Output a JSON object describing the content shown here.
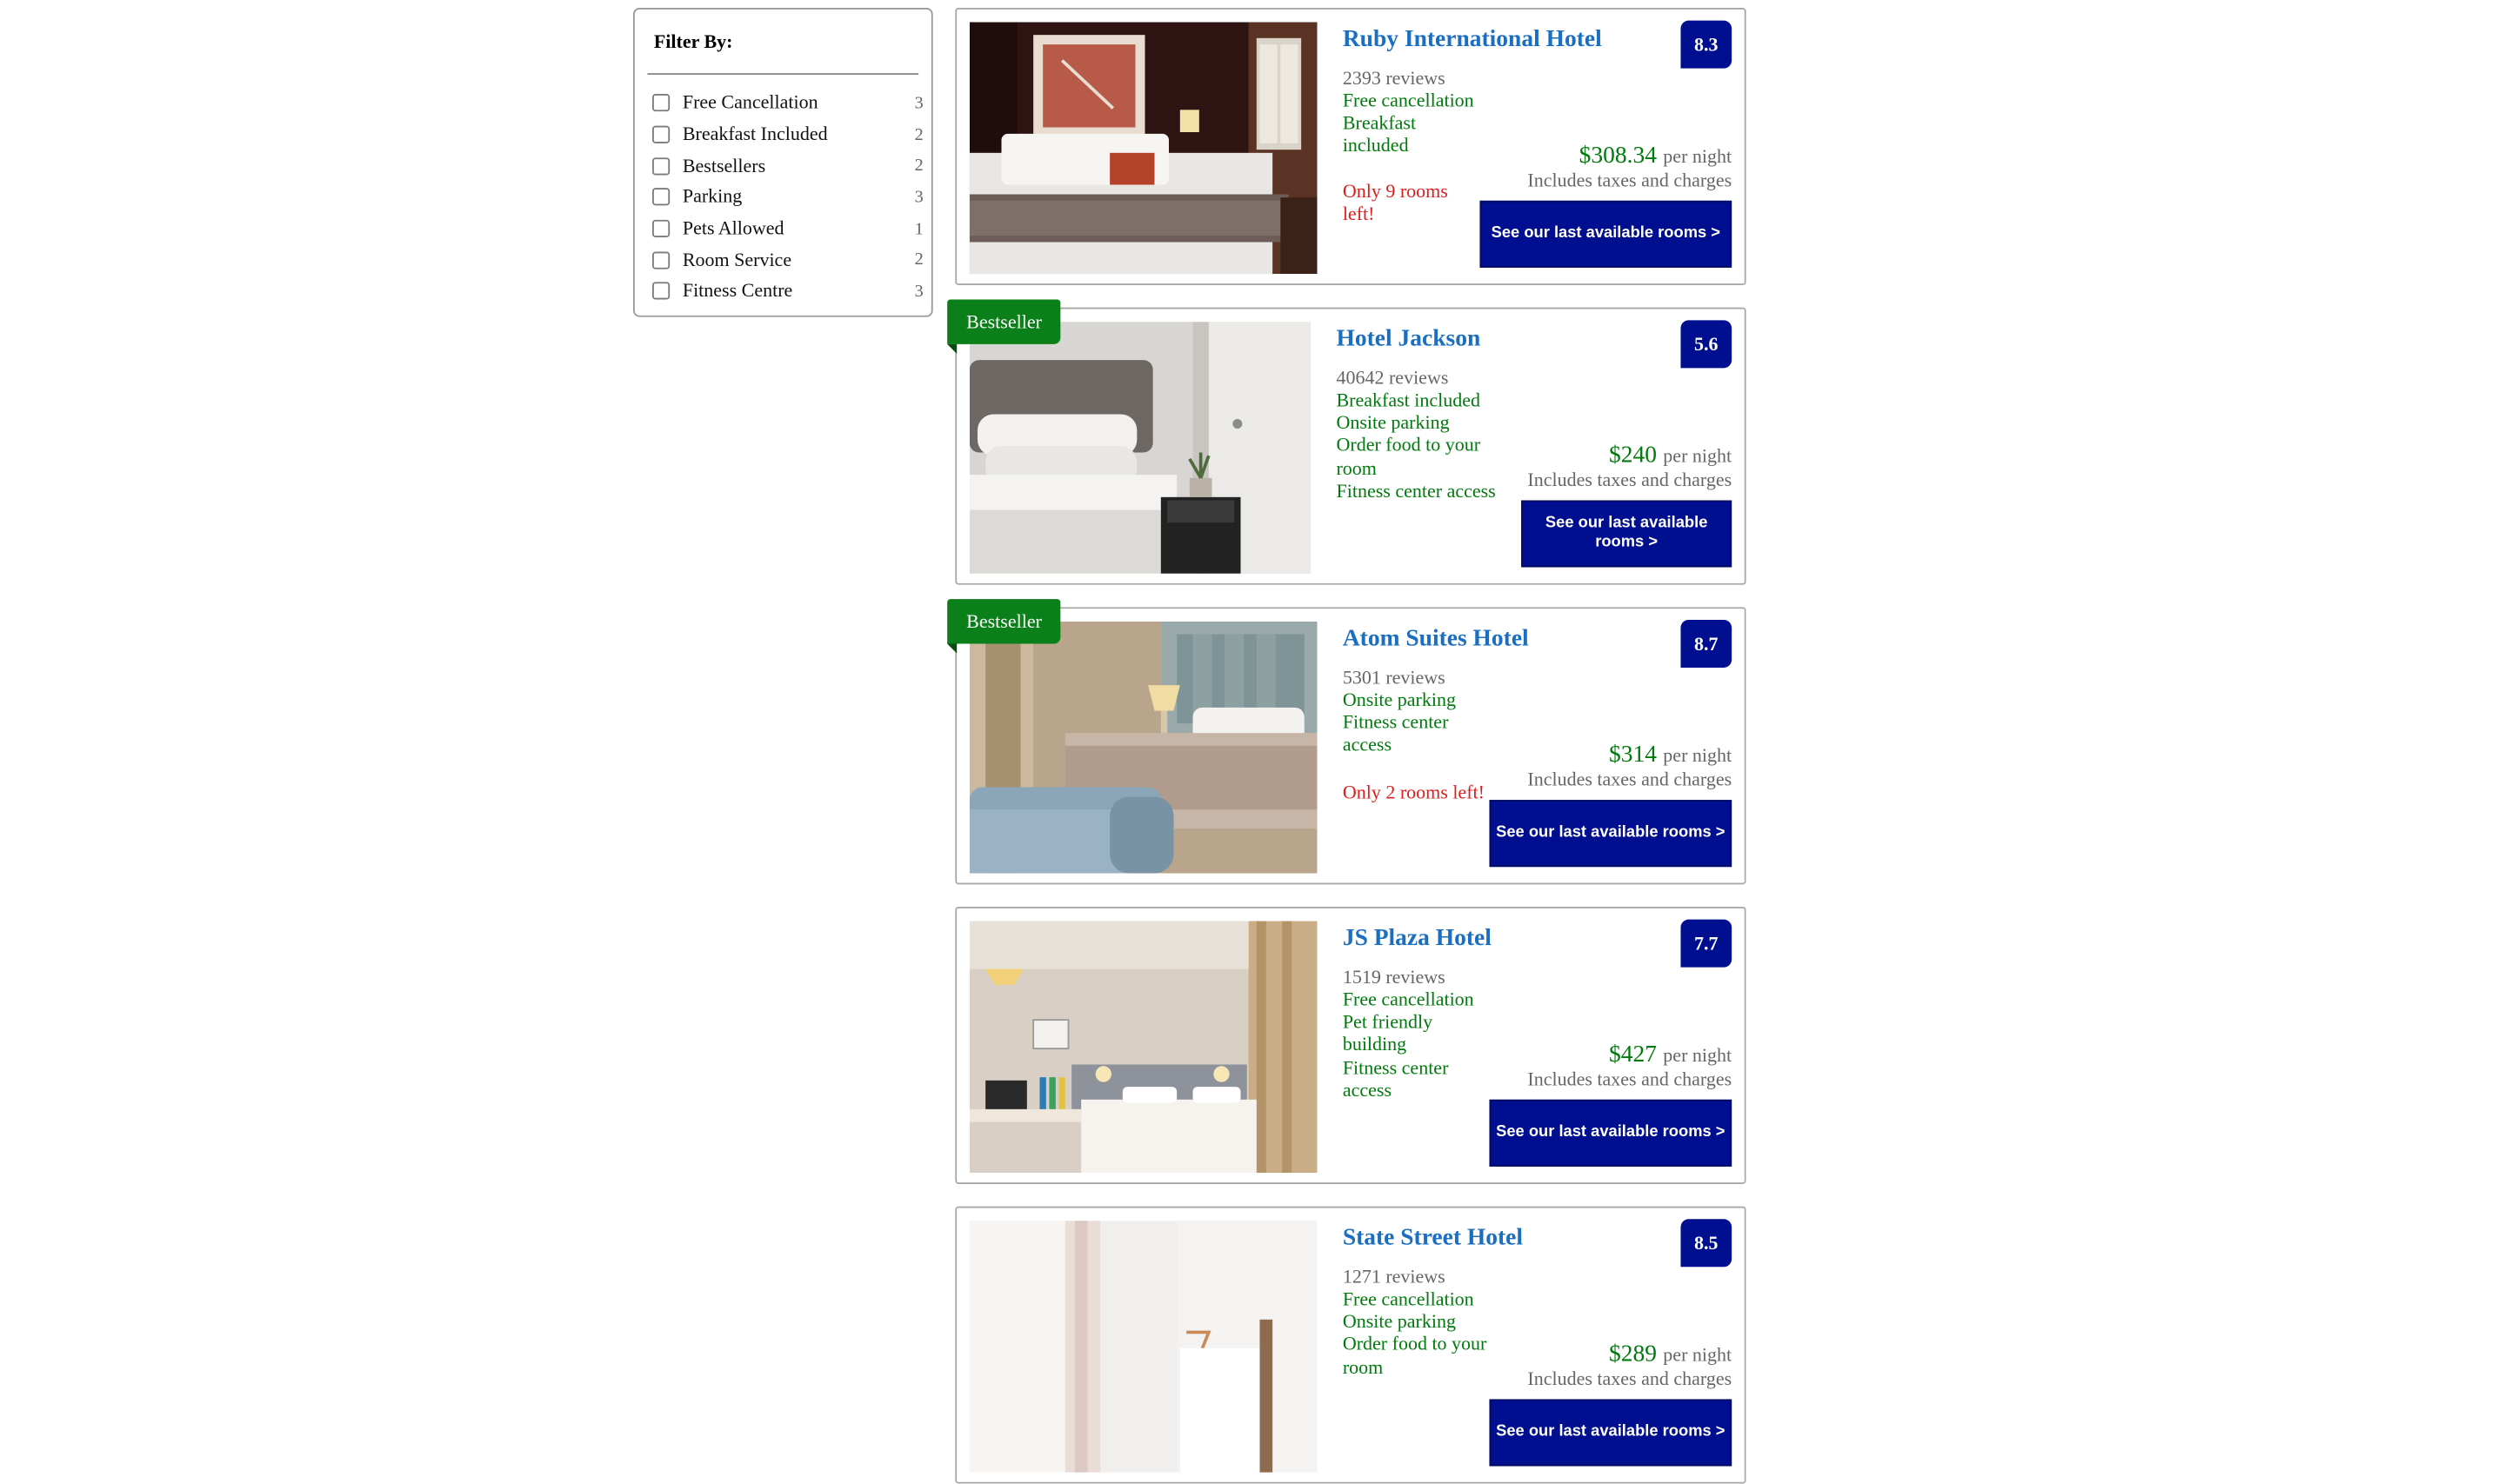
{
  "filters": {
    "title": "Filter By:",
    "items": [
      {
        "label": "Free Cancellation",
        "count": "3"
      },
      {
        "label": "Breakfast Included",
        "count": "2"
      },
      {
        "label": "Bestsellers",
        "count": "2"
      },
      {
        "label": "Parking",
        "count": "3"
      },
      {
        "label": "Pets Allowed",
        "count": "1"
      },
      {
        "label": "Room Service",
        "count": "2"
      },
      {
        "label": "Fitness Centre",
        "count": "3"
      }
    ]
  },
  "hotels": [
    {
      "name": "Ruby International Hotel",
      "score": "8.3",
      "reviews": "2393 reviews",
      "amenities": [
        "Free cancellation",
        "Breakfast included"
      ],
      "rooms_left": "Only 9 rooms left!",
      "price": "$308.34",
      "per_night": "per night",
      "taxes": "Includes taxes and charges",
      "cta": "See our last available rooms >",
      "badge": ""
    },
    {
      "name": "Hotel Jackson",
      "score": "5.6",
      "reviews": "40642 reviews",
      "amenities": [
        "Breakfast included",
        "Onsite parking",
        "Order food to your room",
        "Fitness center access"
      ],
      "rooms_left": "",
      "price": "$240",
      "per_night": "per night",
      "taxes": "Includes taxes and charges",
      "cta": "See our last available rooms >",
      "badge": "Bestseller"
    },
    {
      "name": "Atom Suites Hotel",
      "score": "8.7",
      "reviews": "5301 reviews",
      "amenities": [
        "Onsite parking",
        "Fitness center access"
      ],
      "rooms_left": "Only 2 rooms left!",
      "price": "$314",
      "per_night": "per night",
      "taxes": "Includes taxes and charges",
      "cta": "See our last available rooms >",
      "badge": "Bestseller"
    },
    {
      "name": "JS Plaza Hotel",
      "score": "7.7",
      "reviews": "1519 reviews",
      "amenities": [
        "Free cancellation",
        "Pet friendly building",
        "Fitness center access"
      ],
      "rooms_left": "",
      "price": "$427",
      "per_night": "per night",
      "taxes": "Includes taxes and charges",
      "cta": "See our last available rooms >",
      "badge": ""
    },
    {
      "name": "State Street Hotel",
      "score": "8.5",
      "reviews": "1271 reviews",
      "amenities": [
        "Free cancellation",
        "Onsite parking",
        "Order food to your room"
      ],
      "rooms_left": "",
      "price": "$289",
      "per_night": "per night",
      "taxes": "Includes taxes and charges",
      "cta": "See our last available rooms >",
      "badge": ""
    }
  ],
  "colors": {
    "link_blue": "#1b6fc2",
    "navy": "#000f8f",
    "green": "#007a0c",
    "badge_green": "#0b7f19",
    "alert_red": "#e01d1d"
  }
}
